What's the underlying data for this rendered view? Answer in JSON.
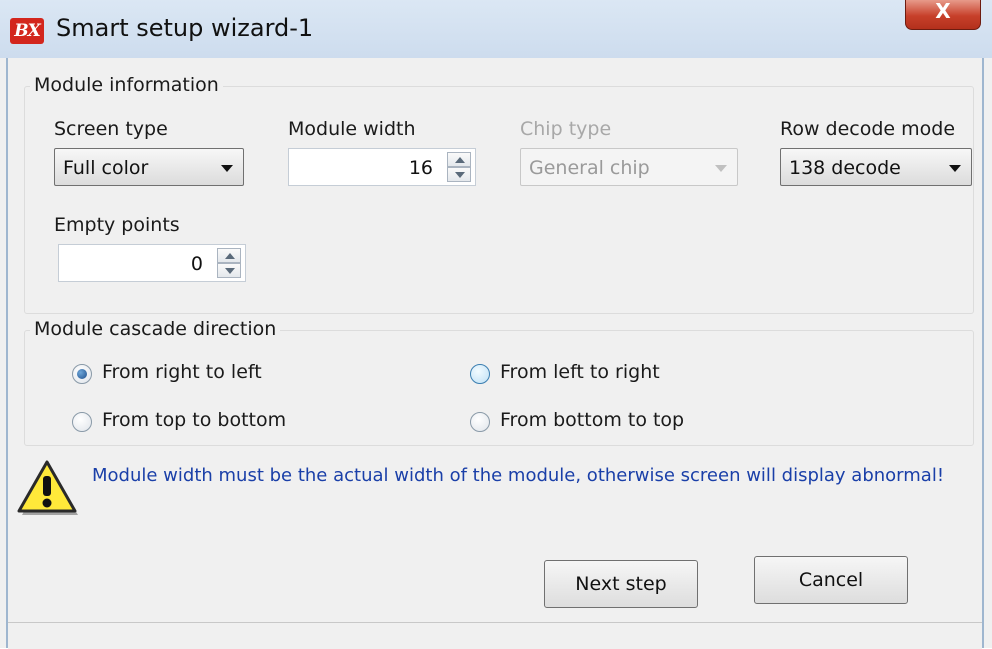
{
  "window": {
    "title": "Smart setup wizard-1",
    "logo_text": "BX",
    "close_glyph": "X",
    "colors": {
      "title_bar": "#cddcee",
      "close": "#c7402a",
      "warning_text": "#1a3fa8"
    }
  },
  "module_info": {
    "title": "Module information",
    "screen_type": {
      "label": "Screen type",
      "value": "Full color"
    },
    "module_width": {
      "label": "Module width",
      "value": "16"
    },
    "chip_type": {
      "label": "Chip type",
      "value": "General chip",
      "disabled": true
    },
    "row_decode": {
      "label": "Row decode mode",
      "value": "138 decode"
    },
    "empty_points": {
      "label": "Empty points",
      "value": "0"
    }
  },
  "cascade": {
    "title": "Module cascade direction",
    "options": [
      {
        "label": "From right to left",
        "checked": true
      },
      {
        "label": "From left to right",
        "checked": false
      },
      {
        "label": "From top to bottom",
        "checked": false
      },
      {
        "label": "From bottom to top",
        "checked": false
      }
    ]
  },
  "warning": {
    "icon": "warning-triangle-icon",
    "message": "Module width must be the actual width of the module, otherwise screen will display abnormal!"
  },
  "buttons": {
    "next_label": "Next step",
    "cancel_label": "Cancel"
  }
}
